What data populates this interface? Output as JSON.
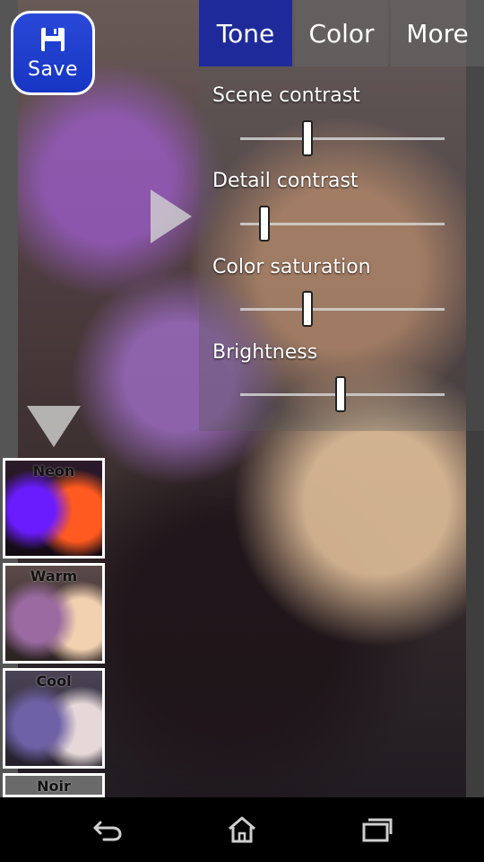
{
  "toolbar": {
    "save_label": "Save"
  },
  "tabs": [
    {
      "label": "Tone"
    },
    {
      "label": "Color"
    },
    {
      "label": "More"
    }
  ],
  "sliders": [
    {
      "label": "Scene contrast",
      "value": 0.33
    },
    {
      "label": "Detail contrast",
      "value": 0.12
    },
    {
      "label": "Color saturation",
      "value": 0.33
    },
    {
      "label": "Brightness",
      "value": 0.49
    }
  ],
  "presets": [
    {
      "label": "Neon"
    },
    {
      "label": "Warm"
    },
    {
      "label": "Cool"
    },
    {
      "label": "Noir"
    }
  ],
  "icons": {
    "save": "floppy-disk-icon",
    "next": "play-triangle-icon",
    "expand": "down-triangle-icon",
    "back": "back-icon",
    "home": "home-icon",
    "recent": "recent-apps-icon"
  },
  "colors": {
    "save_bg": "#1f3fcf",
    "active_tab": "#1f2a9a",
    "tab_bg": "#6a6a6a"
  }
}
